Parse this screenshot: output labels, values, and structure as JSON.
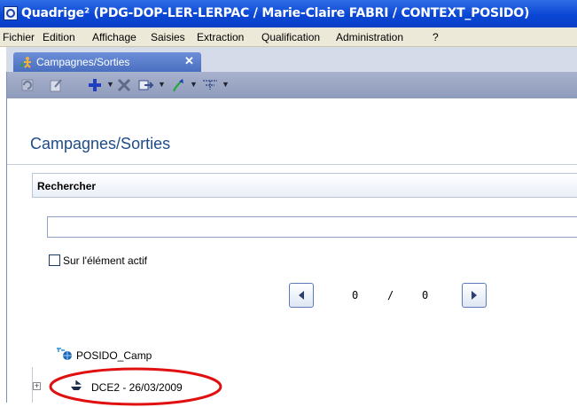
{
  "window": {
    "title": "Quadrige² (PDG-DOP-LER-LERPAC / Marie-Claire FABRI / CONTEXT_POSIDO)"
  },
  "menu": {
    "items": [
      "Fichier",
      "Edition",
      "Affichage",
      "Saisies",
      "Extraction",
      "Qualification",
      "Administration",
      "?"
    ]
  },
  "tab": {
    "label": "Campagnes/Sorties",
    "close": "✕"
  },
  "toolbar": {
    "icons": [
      "refresh-icon",
      "edit-icon",
      "add-icon",
      "delete-icon",
      "export-icon",
      "sort-icon",
      "tree-filter-icon"
    ]
  },
  "view": {
    "title": "Campagnes/Sorties"
  },
  "search": {
    "header": "Rechercher",
    "input_value": "",
    "checkbox_label": "Sur l'élément actif",
    "checkbox_checked": false,
    "current": "0",
    "separator": "/",
    "total": "0"
  },
  "tree": {
    "root_label": "POSIDO_Camp",
    "children": [
      {
        "label": "DCE2 - 26/03/2009",
        "expander": "+"
      }
    ]
  },
  "colors": {
    "title_bar": "#0a46d4",
    "menu_bg": "#ece9d8",
    "toolbar_bg": "#98a3c2",
    "view_title": "#1e4b8a",
    "highlight_circle": "#e01010"
  }
}
